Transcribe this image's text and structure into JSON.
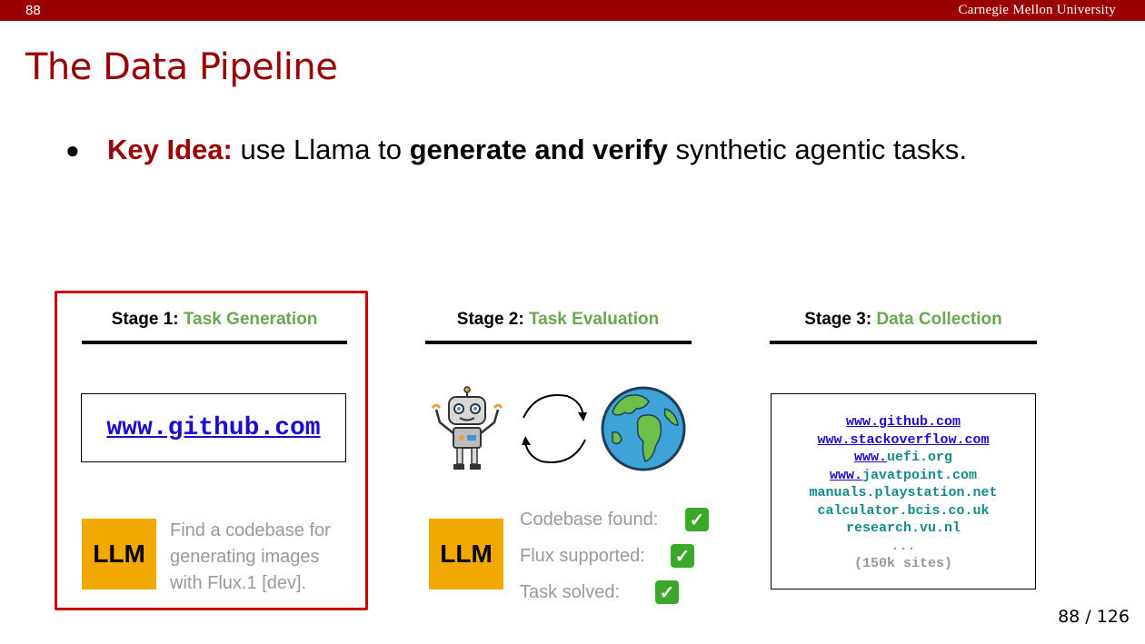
{
  "header": {
    "slide_number": "88",
    "institution": "Carnegie Mellon University"
  },
  "title": "The Data Pipeline",
  "bullet": {
    "lead": "Key Idea:",
    "text_1": " use Llama to ",
    "emphasis": "generate and verify",
    "text_2": " synthetic agentic tasks."
  },
  "stages": [
    {
      "prefix": "Stage 1: ",
      "name": "Task Generation"
    },
    {
      "prefix": "Stage 2: ",
      "name": "Task Evaluation"
    },
    {
      "prefix": "Stage 3: ",
      "name": "Data Collection"
    }
  ],
  "stage1": {
    "url": "www.github.com",
    "llm_label": "LLM",
    "task": "Find a codebase for generating images with Flux.1 [dev]."
  },
  "stage2": {
    "llm_label": "LLM",
    "checks": [
      {
        "label": "Codebase found:",
        "mark": "✓"
      },
      {
        "label": "Flux supported:",
        "mark": "✓"
      },
      {
        "label": "Task solved:",
        "mark": "✓"
      }
    ]
  },
  "stage3": {
    "sites": [
      {
        "prefix": "www.github.com",
        "rest": ""
      },
      {
        "prefix": "www.stackoverflow.com",
        "rest": ""
      },
      {
        "prefix": "www.",
        "rest": "uefi.org"
      },
      {
        "prefix": "www.",
        "rest": "javatpoint.com"
      },
      {
        "prefix": "",
        "rest": "manuals.playstation.net"
      },
      {
        "prefix": "",
        "rest": "calculator.bcis.co.uk"
      },
      {
        "prefix": "",
        "rest": "research.vu.nl"
      }
    ],
    "ellipsis": "...",
    "count": "(150k sites)"
  },
  "pager": "88 / 126",
  "colors": {
    "brand": "#990000",
    "accent_green": "#6aa84f",
    "llm_box": "#f1a800",
    "check": "#3aa829"
  },
  "icons": [
    "robot-icon",
    "cycle-arrows-icon",
    "globe-icon",
    "checkmark-icon"
  ]
}
